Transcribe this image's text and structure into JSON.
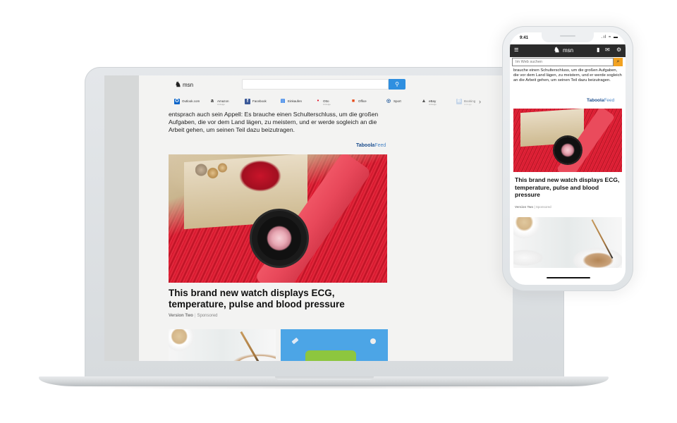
{
  "laptop": {
    "header": {
      "logo_text": "msn",
      "logo_glyph": "♞",
      "search_placeholder": "",
      "search_icon": "search-icon"
    },
    "quicklinks": [
      {
        "label": "Outlook.com",
        "sub": "",
        "icon": "outlook-icon",
        "color": "#0a64c8",
        "glyph": "O"
      },
      {
        "label": "Amazon",
        "sub": "Anzeige",
        "icon": "amazon-icon",
        "color": "#222222",
        "glyph": "a"
      },
      {
        "label": "Facebook",
        "sub": "",
        "icon": "facebook-icon",
        "color": "#3b5998",
        "glyph": "f"
      },
      {
        "label": "Einkaufen",
        "sub": "",
        "icon": "shopping-cart-icon",
        "color": "#1a73e8",
        "glyph": "▤"
      },
      {
        "label": "Otto",
        "sub": "Anzeige",
        "icon": "otto-icon",
        "color": "#e2001a",
        "glyph": "•"
      },
      {
        "label": "Office",
        "sub": "",
        "icon": "office-icon",
        "color": "#e64a19",
        "glyph": "■"
      },
      {
        "label": "Sport",
        "sub": "",
        "icon": "sport-icon",
        "color": "#2b5f9e",
        "glyph": "◎"
      },
      {
        "label": "eBay",
        "sub": "Anzeige",
        "icon": "ebay-icon",
        "color": "#555555",
        "glyph": "▲"
      },
      {
        "label": "Booking",
        "sub": "Anzeige",
        "icon": "booking-icon",
        "color": "#a9c4e4",
        "glyph": "B"
      }
    ],
    "next_icon": "chevron-right-icon",
    "article_text": "entsprach auch sein Appell: Es brauche einen Schulterschluss, um die großen Aufgaben, die vor dem Land lägen, zu meistern, und er werde sogleich an die Arbeit gehen, um seinen Teil dazu beizutragen.",
    "taboola_brand": "Taboola",
    "taboola_feed": "Feed",
    "headline": "This brand new watch displays ECG, temperature, pulse and blood pressure",
    "source": "Version Two",
    "separator": "|",
    "sponsored": "Sponsored"
  },
  "phone": {
    "status_time": "9:41",
    "status_icons": "signal wifi battery",
    "status_glyphs": ".ıl ≈ ▬",
    "menu_glyph": "≡",
    "logo_text": "msn",
    "logo_glyph": "♞",
    "header_icons": [
      {
        "name": "phone-icon",
        "glyph": "▮"
      },
      {
        "name": "mail-icon",
        "glyph": "✉"
      },
      {
        "name": "settings-gear-icon",
        "glyph": "⚙"
      }
    ],
    "search_placeholder": "Im Web suchen",
    "search_glyph": "⌕",
    "article_text": "brauche einen Schulterschluss, um die großen Aufgaben, die vor dem Land lägen, zu meistern, und er werde sogleich an die Arbeit gehen, um seinen Teil dazu beizutragen.",
    "taboola_brand": "Taboola",
    "taboola_feed": "Feed",
    "headline": "This brand new watch displays ECG, temperature, pulse and blood pressure",
    "source": "Version Two",
    "separator": "|",
    "sponsored": "Sponsored"
  }
}
